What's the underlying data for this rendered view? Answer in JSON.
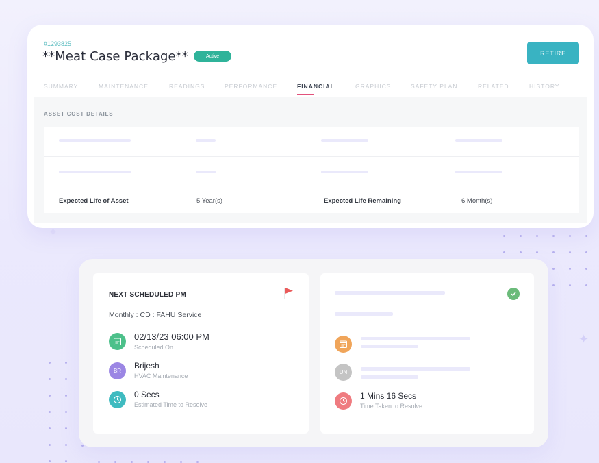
{
  "asset": {
    "id": "#1293825",
    "title": "**Meat Case Package**",
    "status": "Active",
    "retire_label": "RETIRE"
  },
  "tabs": [
    {
      "label": "SUMMARY",
      "active": false
    },
    {
      "label": "MAINTENANCE",
      "active": false
    },
    {
      "label": "READINGS",
      "active": false
    },
    {
      "label": "PERFORMANCE",
      "active": false
    },
    {
      "label": "FINANCIAL",
      "active": true
    },
    {
      "label": "GRAPHICS",
      "active": false
    },
    {
      "label": "SAFETY PLAN",
      "active": false
    },
    {
      "label": "RELATED",
      "active": false
    },
    {
      "label": "HISTORY",
      "active": false
    }
  ],
  "financial": {
    "section_title": "ASSET COST DETAILS",
    "expected_life_label": "Expected Life of Asset",
    "expected_life_value": "5 Year(s)",
    "remaining_label": "Expected Life Remaining",
    "remaining_value": "6 Month(s)"
  },
  "pm": {
    "title": "NEXT SCHEDULED PM",
    "subtitle": "Monthly : CD : FAHU Service",
    "scheduled_value": "02/13/23 06:00 PM",
    "scheduled_label": "Scheduled On",
    "assignee_initials": "BR",
    "assignee_name": "Brijesh",
    "assignee_team": "HVAC Maintenance",
    "estimate_value": "0 Secs",
    "estimate_label": "Estimated Time to Resolve"
  },
  "completed": {
    "assignee_initials": "UN",
    "resolve_value": "1 Mins 16 Secs",
    "resolve_label": "Time Taken to Resolve"
  },
  "colors": {
    "accent_teal": "#39b3c2",
    "active_badge": "#2fb39a",
    "tab_underline": "#e2527c",
    "calendar_green": "#4cc08a",
    "avatar_purple": "#9b86e4",
    "clock_teal": "#3fbbc0",
    "calendar_orange": "#f0a55a",
    "avatar_gray": "#c4c4c4",
    "clock_red": "#ef7b80",
    "check_green": "#6bbb7a",
    "flag_red": "#ea5a5a"
  }
}
